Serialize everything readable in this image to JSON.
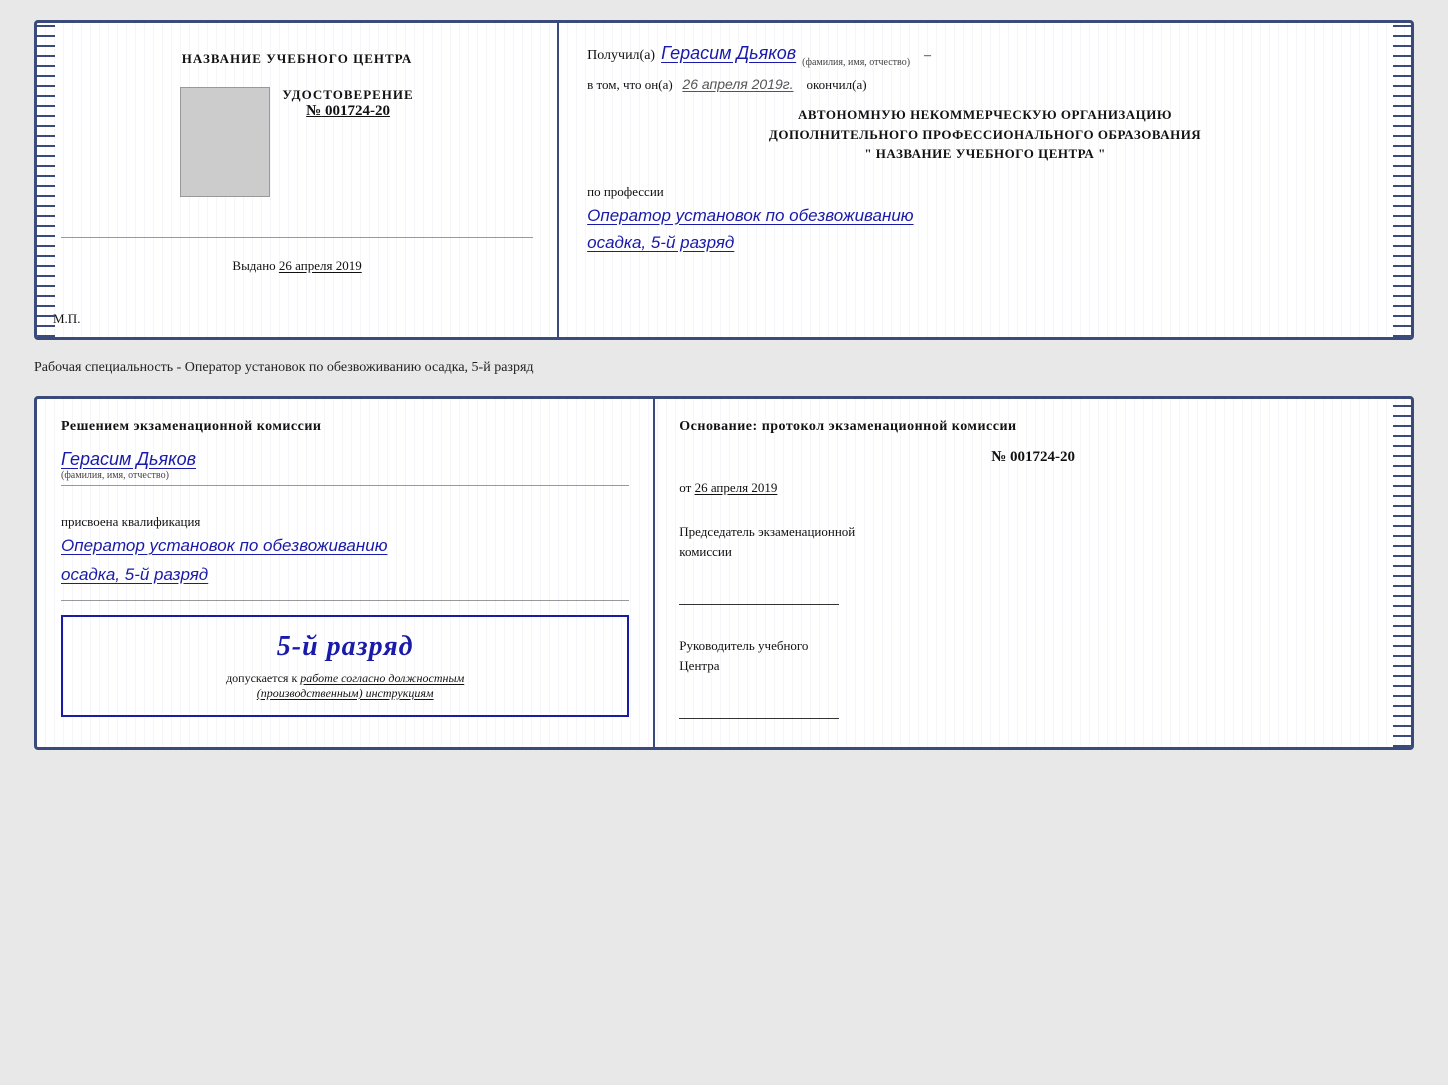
{
  "cert1": {
    "left": {
      "title": "НАЗВАНИЕ УЧЕБНОГО ЦЕНТРА",
      "cert_label": "УДОСТОВЕРЕНИЕ",
      "cert_number_prefix": "№",
      "cert_number": "001724-20",
      "issued_label": "Выдано",
      "issued_date": "26 апреля 2019",
      "mp": "М.П."
    },
    "right": {
      "received_label": "Получил(а)",
      "recipient_name": "Герасим Дьяков",
      "fio_sub": "(фамилия, имя, отчество)",
      "dash": "–",
      "in_that_label": "в том, что он(а)",
      "completion_date": "26 апреля 2019г.",
      "completed_label": "окончил(а)",
      "org_line1": "АВТОНОМНУЮ НЕКОММЕРЧЕСКУЮ ОРГАНИЗАЦИЮ",
      "org_line2": "ДОПОЛНИТЕЛЬНОГО ПРОФЕССИОНАЛЬНОГО ОБРАЗОВАНИЯ",
      "org_line3": "\"  НАЗВАНИЕ УЧЕБНОГО ЦЕНТРА  \"",
      "profession_label": "по профессии",
      "profession_text": "Оператор установок по обезвоживанию",
      "profession_text2": "осадка, 5-й разряд"
    }
  },
  "description": {
    "text": "Рабочая специальность - Оператор установок по обезвоживанию осадка, 5-й разряд"
  },
  "cert2": {
    "left": {
      "decision_label": "Решением экзаменационной комиссии",
      "recipient_name": "Герасим Дьяков",
      "fio_sub": "(фамилия, имя, отчество)",
      "qualification_label": "присвоена квалификация",
      "qualification_text": "Оператор установок по обезвоживанию",
      "qualification_text2": "осадка, 5-й разряд",
      "stamp_rank": "5-й разряд",
      "stamp_allowed": "допускается к",
      "stamp_work": "работе согласно должностным",
      "stamp_instructions": "(производственным) инструкциям"
    },
    "right": {
      "basis_label": "Основание: протокол экзаменационной комиссии",
      "protocol_number": "№ 001724-20",
      "protocol_date_prefix": "от",
      "protocol_date": "26 апреля 2019",
      "chairman_label": "Председатель экзаменационной",
      "chairman_label2": "комиссии",
      "director_label": "Руководитель учебного",
      "director_label2": "Центра"
    }
  }
}
